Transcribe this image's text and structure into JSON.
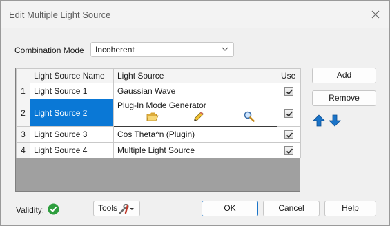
{
  "window": {
    "title": "Edit Multiple Light Source"
  },
  "combination": {
    "label": "Combination Mode",
    "value": "Incoherent"
  },
  "table": {
    "headers": {
      "name": "Light Source Name",
      "source": "Light Source",
      "use": "Use"
    },
    "rows": [
      {
        "num": "1",
        "name": "Light Source 1",
        "source": "Gaussian Wave",
        "use": true
      },
      {
        "num": "2",
        "name": "Light Source 2",
        "source": "Plug-In Mode Generator",
        "use": true
      },
      {
        "num": "3",
        "name": "Light Source 3",
        "source": "Cos Theta^n (Plugin)",
        "use": true
      },
      {
        "num": "4",
        "name": "Light Source 4",
        "source": "Multiple Light Source",
        "use": true
      }
    ]
  },
  "side_buttons": {
    "add": "Add",
    "remove": "Remove"
  },
  "footer": {
    "validity_label": "Validity:",
    "tools_label": "Tools",
    "ok": "OK",
    "cancel": "Cancel",
    "help": "Help"
  },
  "colors": {
    "selection": "#0a78d6",
    "valid": "#2e9e3e",
    "arrow": "#1a74c8"
  },
  "icons": {
    "close": "close-icon",
    "open": "folder-open-icon",
    "edit": "pencil-icon",
    "inspect": "magnifier-icon",
    "up": "arrow-up-icon",
    "down": "arrow-down-icon",
    "validity": "check-circle-icon",
    "tools": "tools-icon"
  }
}
